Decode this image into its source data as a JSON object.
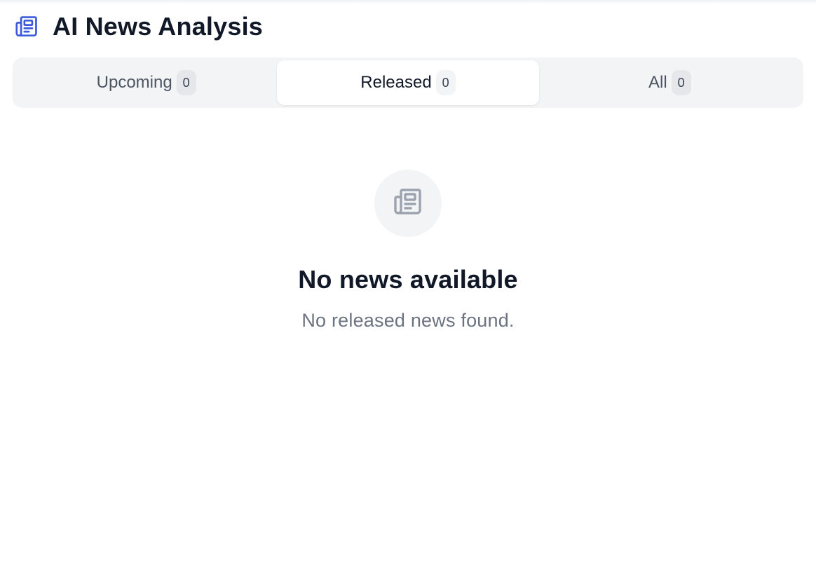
{
  "header": {
    "title": "AI News Analysis",
    "icon": "newspaper-icon",
    "icon_color": "#3b5bdb"
  },
  "tabs": [
    {
      "label": "Upcoming",
      "count": "0",
      "active": false
    },
    {
      "label": "Released",
      "count": "0",
      "active": true
    },
    {
      "label": "All",
      "count": "0",
      "active": false
    }
  ],
  "empty_state": {
    "icon": "newspaper-icon",
    "icon_color": "#9ca3af",
    "title": "No news available",
    "subtitle": "No released news found."
  }
}
